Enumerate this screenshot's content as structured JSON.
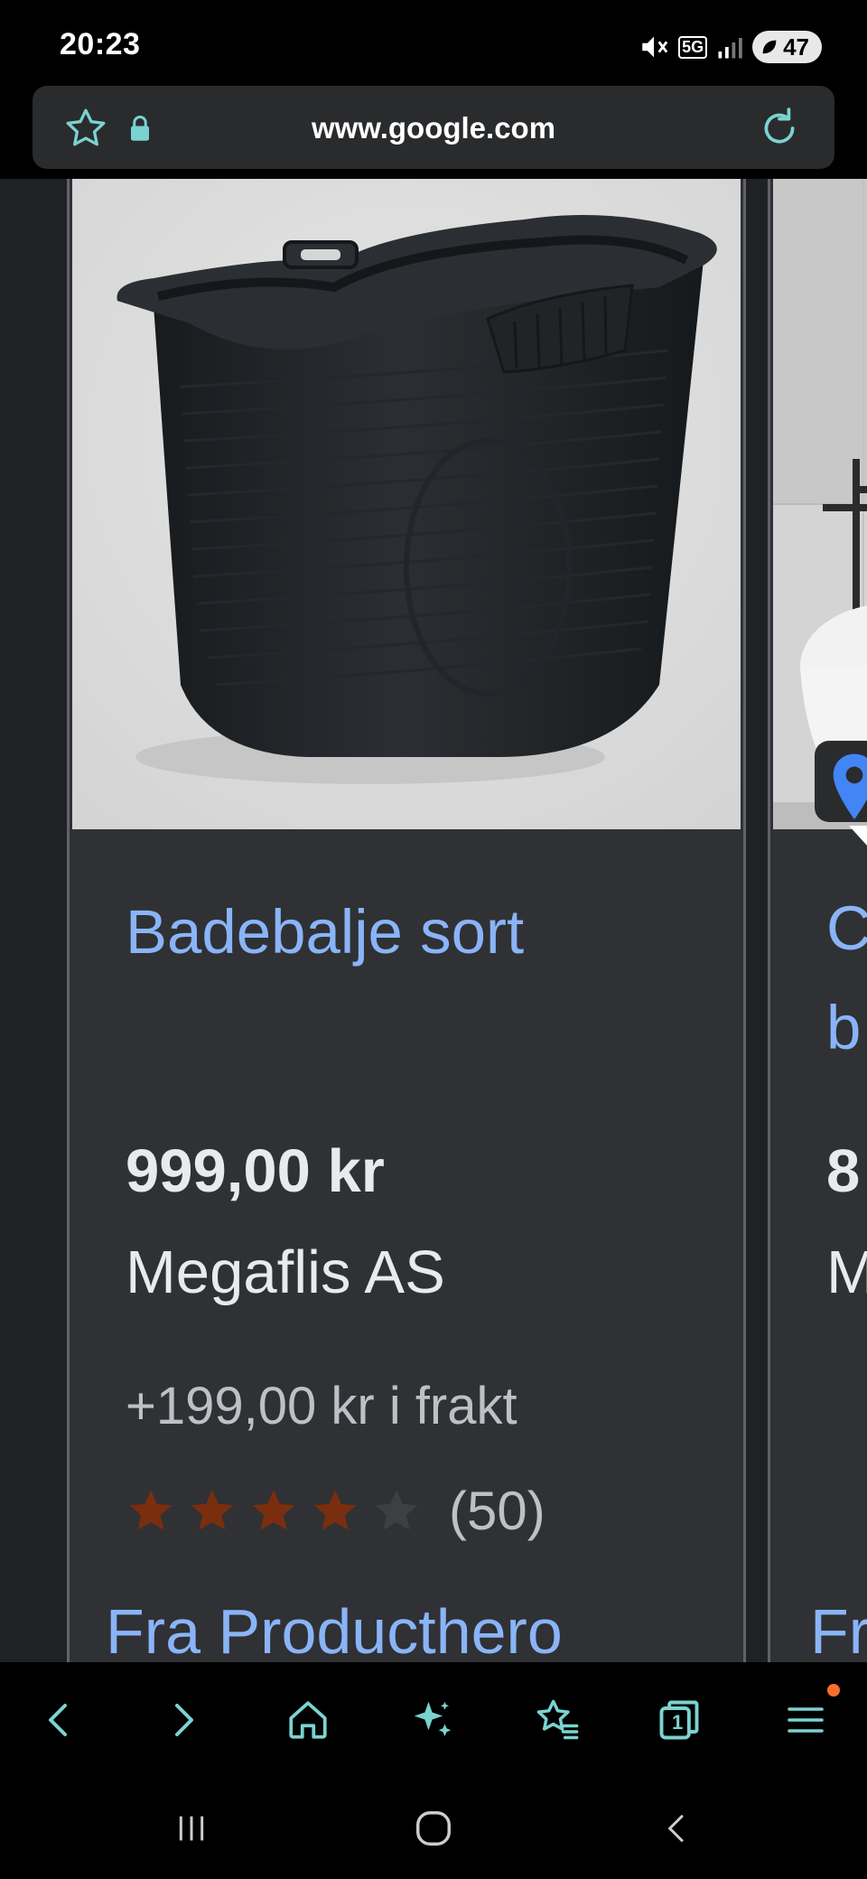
{
  "status_bar": {
    "time": "20:23",
    "network": "5G",
    "battery": "47"
  },
  "browser": {
    "url": "www.google.com"
  },
  "product": {
    "title": "Badebalje sort",
    "price": "999,00 kr",
    "seller": "Megaflis AS",
    "shipping": "+199,00 kr i frakt",
    "rating": 4,
    "rating_max": 5,
    "review_count": "(50)",
    "from_label": "Fra Producthero"
  },
  "next_product": {
    "title_line1": "C",
    "title_line2": "b",
    "price_partial": "8",
    "seller_partial": "M",
    "from_partial": "Fr"
  },
  "colors": {
    "link": "#8ab4f8",
    "star_filled": "#7a2e0e",
    "star_empty": "#3c4043",
    "accent": "#7ad3d0",
    "notification_dot": "#ff6d2e"
  },
  "icons": [
    "star-icon",
    "lock-icon",
    "reload-icon",
    "back-icon",
    "forward-icon",
    "home-icon",
    "sparkle-icon",
    "bookmarks-icon",
    "tabs-icon",
    "menu-icon"
  ],
  "tabs_count": "1"
}
